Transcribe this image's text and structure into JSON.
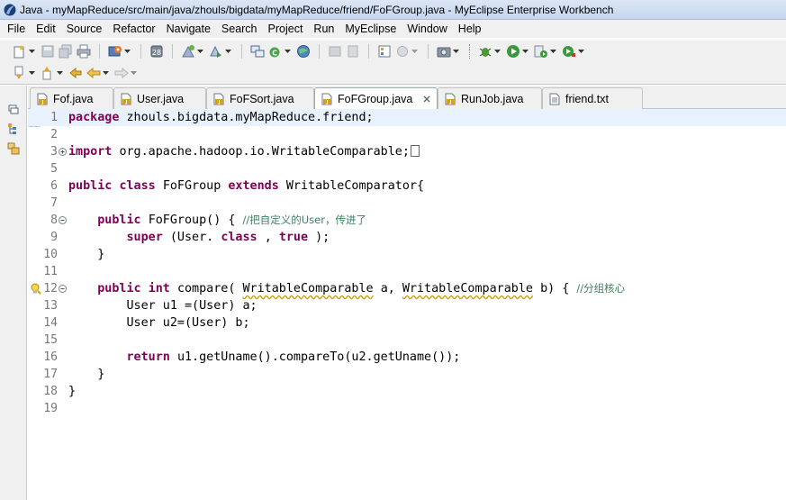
{
  "window": {
    "title": "Java - myMapReduce/src/main/java/zhouls/bigdata/myMapReduce/friend/FoFGroup.java - MyEclipse Enterprise Workbench",
    "app_icon": "myeclipse-logo-icon"
  },
  "menu": {
    "items": [
      "File",
      "Edit",
      "Source",
      "Refactor",
      "Navigate",
      "Search",
      "Project",
      "Run",
      "MyEclipse",
      "Window",
      "Help"
    ]
  },
  "tabs": [
    {
      "label": "Fof.java",
      "icon": "java-file-icon",
      "active": false
    },
    {
      "label": "User.java",
      "icon": "java-file-icon",
      "active": false
    },
    {
      "label": "FoFSort.java",
      "icon": "java-file-icon",
      "active": false
    },
    {
      "label": "FoFGroup.java",
      "icon": "java-file-icon",
      "active": true
    },
    {
      "label": "RunJob.java",
      "icon": "java-file-icon",
      "active": false
    },
    {
      "label": "friend.txt",
      "icon": "text-file-icon",
      "active": false
    }
  ],
  "editor": {
    "lines": [
      {
        "n": "1",
        "segs": [
          [
            "kw",
            "package"
          ],
          [
            "",
            "zhouls.bigdata.myMapReduce.friend;"
          ]
        ]
      },
      {
        "n": "2",
        "segs": []
      },
      {
        "n": "3",
        "segs": [
          [
            "kw",
            "import"
          ],
          [
            "",
            "org.apache.hadoop.io.WritableComparable;"
          ]
        ]
      },
      {
        "n": "5",
        "segs": []
      },
      {
        "n": "6",
        "segs": [
          [
            "kw",
            "public"
          ],
          [
            "kw",
            "class"
          ],
          [
            "",
            "FoFGroup"
          ],
          [
            "kw",
            "extends"
          ],
          [
            "",
            "WritableComparator{"
          ]
        ]
      },
      {
        "n": "7",
        "segs": []
      },
      {
        "n": "8",
        "segs": [
          [
            "kw",
            "public"
          ],
          [
            "",
            "FoFGroup() {"
          ],
          [
            "cm",
            "//把自定义的User，传进了"
          ]
        ]
      },
      {
        "n": "9",
        "segs": [
          [
            "kw",
            "super"
          ],
          [
            "",
            "(User."
          ],
          [
            "kw",
            "class"
          ],
          [
            "",
            ","
          ],
          [
            "kw",
            "true"
          ],
          [
            "",
            ");"
          ]
        ]
      },
      {
        "n": "10",
        "segs": [
          [
            "",
            "}"
          ]
        ]
      },
      {
        "n": "11",
        "segs": []
      },
      {
        "n": "12",
        "segs": [
          [
            "kw",
            "public"
          ],
          [
            "kw",
            "int"
          ],
          [
            "",
            "compare("
          ],
          [
            "wv",
            "WritableComparable"
          ],
          [
            "",
            "a,"
          ],
          [
            "wv",
            "WritableComparable"
          ],
          [
            "",
            "b) {"
          ],
          [
            "cm",
            "//分组核心"
          ]
        ]
      },
      {
        "n": "13",
        "segs": [
          [
            "",
            "User u1 =(User) a;"
          ]
        ]
      },
      {
        "n": "14",
        "segs": [
          [
            "",
            "User u2=(User) b;"
          ]
        ]
      },
      {
        "n": "15",
        "segs": []
      },
      {
        "n": "16",
        "segs": [
          [
            "kw",
            "return"
          ],
          [
            "",
            "u1.getUname().compareTo(u2.getUname());"
          ]
        ]
      },
      {
        "n": "17",
        "segs": [
          [
            "",
            "}"
          ]
        ]
      },
      {
        "n": "18",
        "segs": [
          [
            "",
            "}"
          ]
        ]
      },
      {
        "n": "19",
        "segs": []
      }
    ]
  }
}
